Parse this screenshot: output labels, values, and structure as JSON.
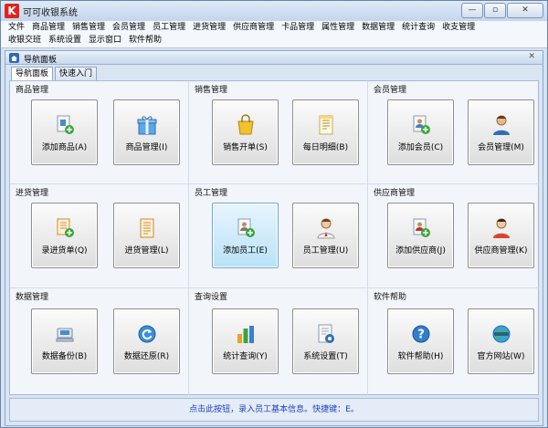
{
  "window": {
    "title": "可可收银系统",
    "logo": "K",
    "min": "—",
    "restore": "▫",
    "close": "✕"
  },
  "menu": {
    "row1": [
      "文件",
      "商品管理",
      "销售管理",
      "会员管理",
      "员工管理",
      "进货管理",
      "供应商管理",
      "卡品管理",
      "属性管理",
      "数据管理",
      "统计查询",
      "收支管理"
    ],
    "row2": [
      "收银交班",
      "系统设置",
      "显示窗口",
      "软件帮助"
    ]
  },
  "panel": {
    "title": "导航面板",
    "close": "✕",
    "tabs": [
      "导航面板",
      "快速入门"
    ]
  },
  "sections": [
    {
      "title": "商品管理",
      "buttons": [
        "添加商品(A)",
        "商品管理(I)"
      ]
    },
    {
      "title": "销售管理",
      "buttons": [
        "销售开单(S)",
        "每日明细(B)"
      ]
    },
    {
      "title": "会员管理",
      "buttons": [
        "添加会员(C)",
        "会员管理(M)"
      ]
    },
    {
      "title": "进货管理",
      "buttons": [
        "录进货单(Q)",
        "进货管理(L)"
      ]
    },
    {
      "title": "员工管理",
      "buttons": [
        "添加员工(E)",
        "员工管理(U)"
      ]
    },
    {
      "title": "供应商管理",
      "buttons": [
        "添加供应商(J)",
        "供应商管理(K)"
      ]
    },
    {
      "title": "数据管理",
      "buttons": [
        "数据备份(B)",
        "数据还原(R)"
      ]
    },
    {
      "title": "查询设置",
      "buttons": [
        "统计查询(Y)",
        "系统设置(T)"
      ]
    },
    {
      "title": "软件帮助",
      "buttons": [
        "软件帮助(H)",
        "官方网站(W)"
      ]
    }
  ],
  "status": "点击此按钮，录入员工基本信息。快捷键：E。",
  "colors": {
    "status_text": "#1f3fbf",
    "highlight_tile": "#b9e2f8",
    "logo_red": "#e2231a"
  }
}
